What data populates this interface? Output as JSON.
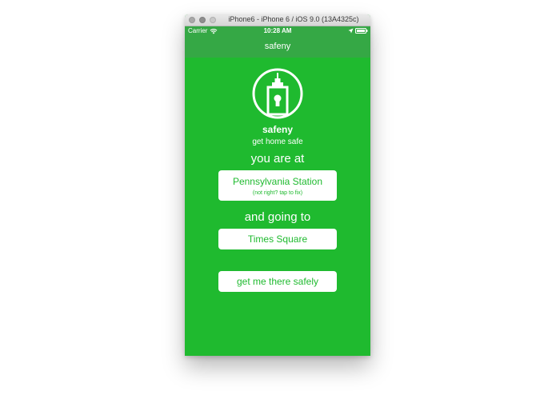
{
  "window": {
    "title": "iPhone6 - iPhone 6 / iOS 9.0 (13A4325c)"
  },
  "status_bar": {
    "carrier": "Carrier",
    "time": "10:28 AM"
  },
  "nav": {
    "title": "safeny"
  },
  "brand": {
    "name": "safeny",
    "tagline": "get home safe"
  },
  "origin": {
    "label": "you are at",
    "value": "Pennsylvania Station",
    "hint": "(not right? tap to fix)"
  },
  "destination": {
    "label": "and going to",
    "value": "Times Square"
  },
  "action": {
    "label": "get me there safely"
  },
  "colors": {
    "primary": "#1fba2f",
    "bar": "#35a845",
    "text_on_primary": "#ffffff"
  },
  "icons": [
    "wifi-icon",
    "location-arrow-icon",
    "battery-icon",
    "building-lock-icon"
  ]
}
